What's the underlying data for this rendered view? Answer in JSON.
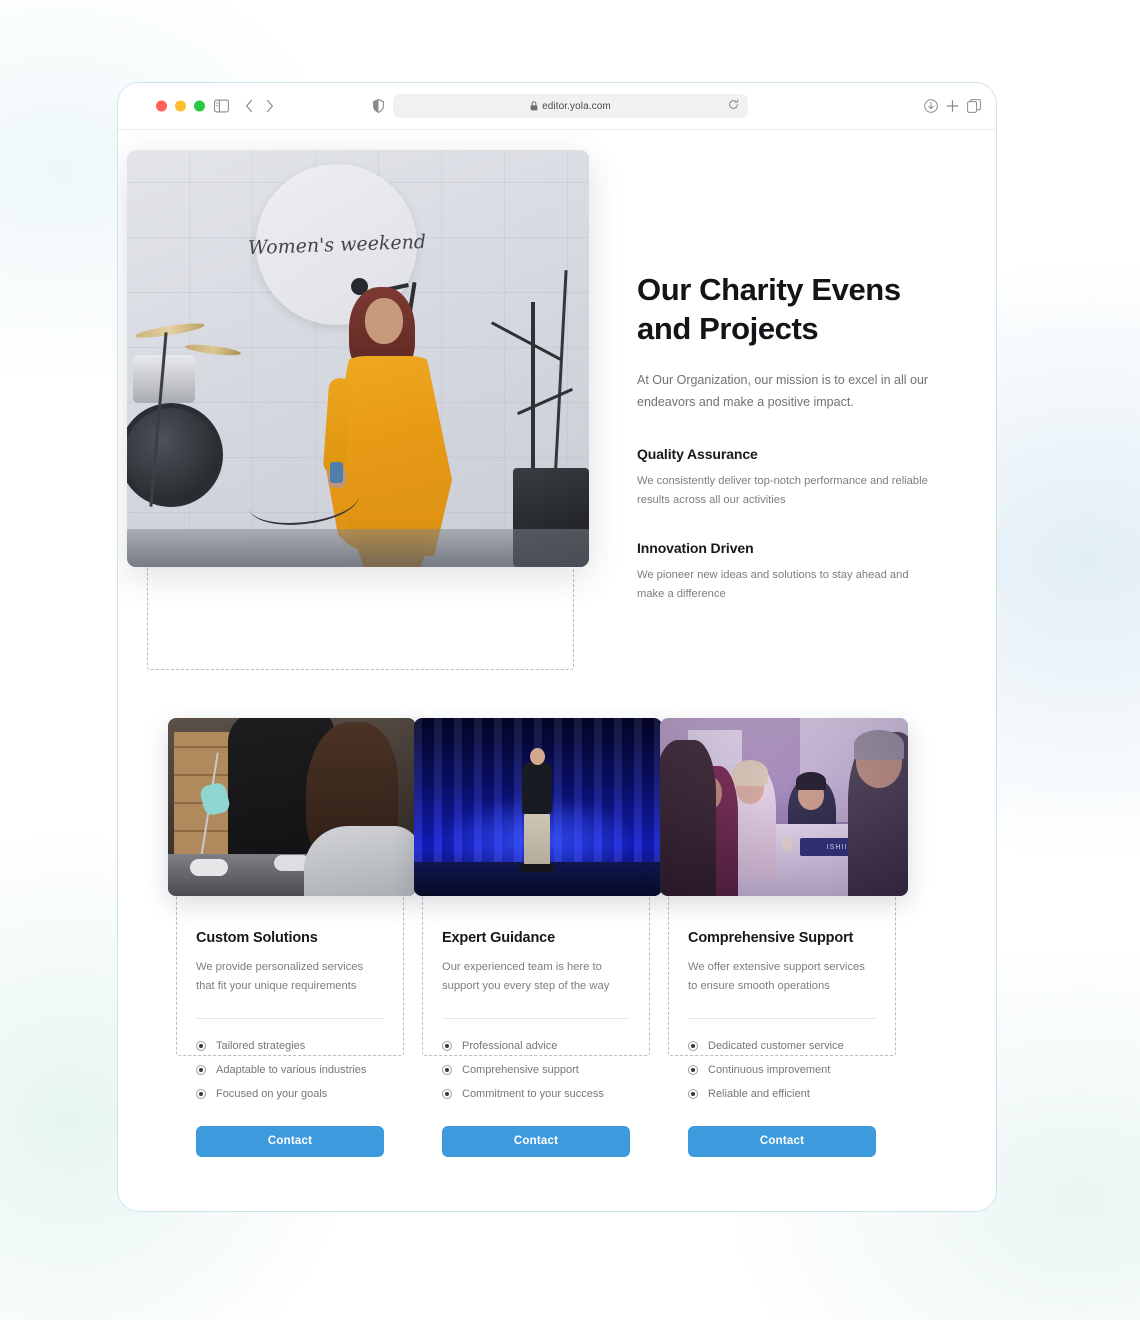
{
  "browser": {
    "url": "editor.yola.com",
    "icons": {
      "sidebar": "sidebar-icon",
      "back": "back-chevron-icon",
      "forward": "forward-chevron-icon",
      "shield": "privacy-shield-icon",
      "lock": "lock-icon",
      "reload": "reload-icon",
      "downloads": "downloads-icon",
      "new_tab": "plus-icon",
      "tabs": "tab-overview-icon"
    },
    "traffic_lights": {
      "close": "#ff5f57",
      "minimize": "#febc2e",
      "zoom": "#28c840"
    }
  },
  "hero": {
    "title": "Our Charity Evens and Projects",
    "subtitle": "At Our Organization, our mission is to excel in all our endeavors and make a positive impact.",
    "image_caption": "Women's weekend",
    "features": [
      {
        "title": "Quality Assurance",
        "description": "We consistently deliver top-notch performance and reliable results across all our activities"
      },
      {
        "title": "Innovation Driven",
        "description": "We pioneer new ideas and solutions to stay ahead and make a difference"
      }
    ]
  },
  "cards": [
    {
      "title": "Custom Solutions",
      "description": "We provide personalized services that fit your unique requirements",
      "items": [
        "Tailored strategies",
        "Adaptable to various industries",
        "Focused on your goals"
      ],
      "button": "Contact"
    },
    {
      "title": "Expert Guidance",
      "description": "Our experienced team is here to support you every step of the way",
      "items": [
        "Professional advice",
        "Comprehensive support",
        "Commitment to your success"
      ],
      "button": "Contact"
    },
    {
      "title": "Comprehensive Support",
      "description": "We offer extensive support services to ensure smooth operations",
      "items": [
        "Dedicated customer service",
        "Continuous improvement",
        "Reliable and efficient"
      ],
      "button": "Contact"
    }
  ],
  "card_images": {
    "third_nameplate": "ISHII"
  },
  "colors": {
    "accent_button": "#3d9bdd",
    "heading": "#121417",
    "body_text": "#7b7e83",
    "selection_outline": "#b9bcc0",
    "window_border": "#cfe3ef"
  }
}
